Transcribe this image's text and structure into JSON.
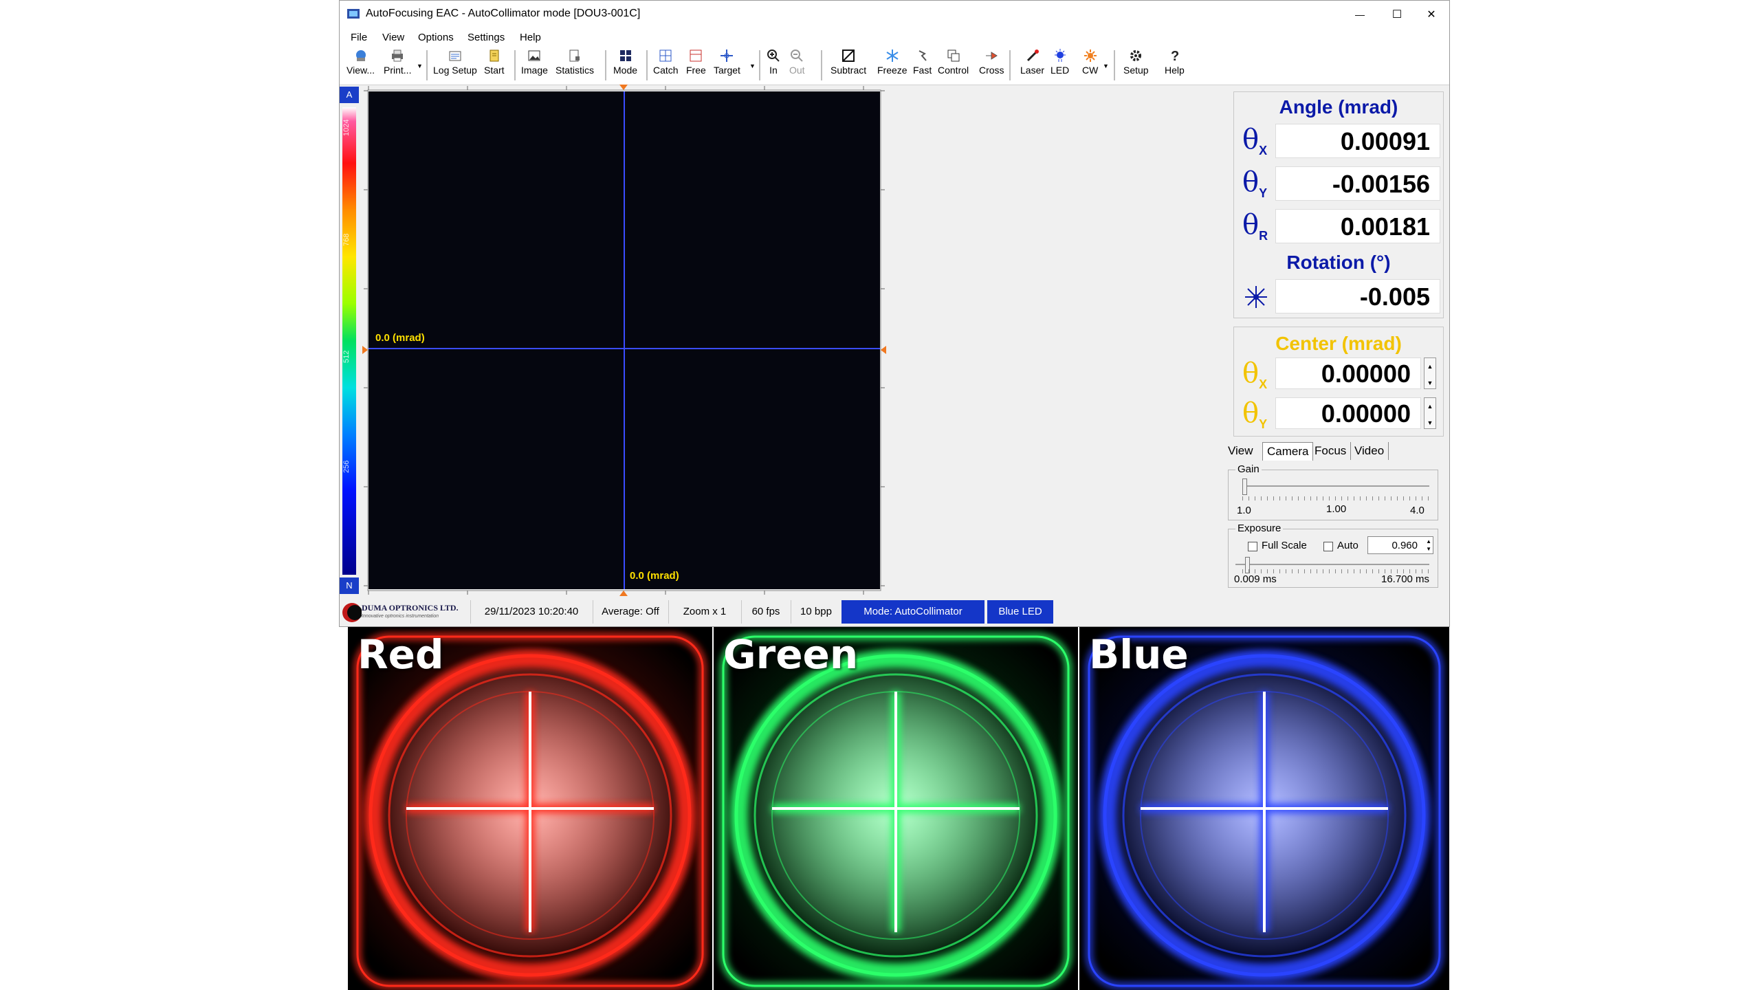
{
  "window": {
    "title": "AutoFocusing EAC - AutoCollimator mode  [DOU3-001C]",
    "controls": {
      "minimize": "—",
      "maximize": "☐",
      "close": "✕"
    }
  },
  "menu": [
    "File",
    "View",
    "Options",
    "Settings",
    "Help"
  ],
  "toolbar": {
    "view": "View...",
    "print": "Print...",
    "log_setup": "Log Setup",
    "start": "Start",
    "image": "Image",
    "statistics": "Statistics",
    "mode": "Mode",
    "catch": "Catch",
    "free": "Free",
    "target": "Target",
    "zoom_in": "In",
    "zoom_out": "Out",
    "subtract": "Subtract",
    "freeze": "Freeze",
    "fast": "Fast",
    "control": "Control",
    "cross": "Cross",
    "laser": "Laser",
    "led": "LED",
    "cw": "CW",
    "setup": "Setup",
    "help": "Help"
  },
  "palette": {
    "top_label": "A",
    "bottom_label": "N",
    "ticks": [
      "1024",
      "768",
      "512",
      "256"
    ]
  },
  "display": {
    "h_cross_label": "0.0 (mrad)",
    "v_cross_label": "0.0 (mrad)",
    "colors": {
      "background": "#05060f",
      "crosshair": "#3a4cff",
      "label": "#ffe000"
    }
  },
  "angle_panel": {
    "title": "Angle (mrad)",
    "rows": [
      {
        "sym": "θ",
        "sub": "X",
        "value": "0.00091"
      },
      {
        "sym": "θ",
        "sub": "Y",
        "value": "-0.00156"
      },
      {
        "sym": "θ",
        "sub": "R",
        "value": "0.00181"
      }
    ],
    "rotation_title": "Rotation (°)",
    "rotation_value": "-0.005",
    "rotation_icon": "rotation-star-icon",
    "color": "#0b1aa8"
  },
  "center_panel": {
    "title": "Center (mrad)",
    "rows": [
      {
        "sym": "θ",
        "sub": "X",
        "value": "0.00000"
      },
      {
        "sym": "θ",
        "sub": "Y",
        "value": "0.00000"
      }
    ],
    "color": "#f2c300"
  },
  "tabs": [
    "View",
    "Camera",
    "Focus",
    "Video"
  ],
  "active_tab": "Camera",
  "gain": {
    "label": "Gain",
    "ticks": [
      "1.0",
      "1.00",
      "4.0"
    ],
    "value_fraction": 0.0
  },
  "exposure": {
    "label": "Exposure",
    "full_scale": "Full Scale",
    "auto": "Auto",
    "value": "0.960",
    "min": "0.009 ms",
    "max": "16.700 ms",
    "value_fraction": 0.05
  },
  "statusbar": {
    "logo_name": "DUMA OPTRONICS LTD.",
    "logo_tagline": "Innovative optronics instrumentation",
    "datetime": "29/11/2023 10:20:40",
    "average": "Average: Off",
    "zoom": "Zoom x 1",
    "fps": "60 fps",
    "bpp": "10 bpp",
    "mode": "Mode: AutoCollimator",
    "led": "Blue LED"
  },
  "photos": [
    {
      "label": "Red",
      "color": "#ff2a1a",
      "bg": "#2a0503"
    },
    {
      "label": "Green",
      "color": "#2cff6a",
      "bg": "#021a08"
    },
    {
      "label": "Blue",
      "color": "#2a44ff",
      "bg": "#02051e"
    }
  ]
}
